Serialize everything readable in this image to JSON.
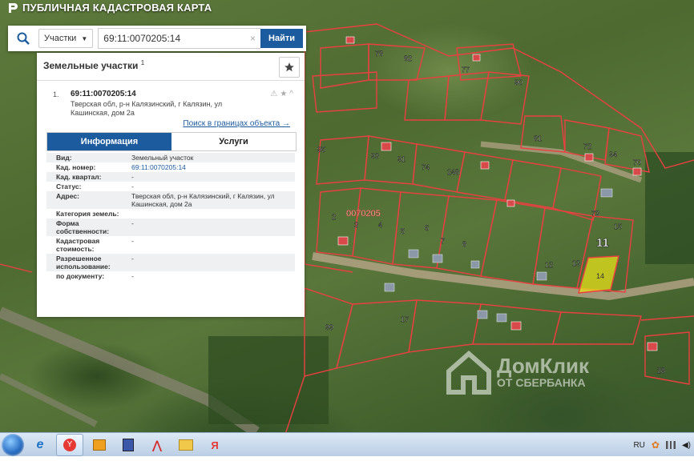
{
  "app": {
    "title": "ПУБЛИЧНАЯ КАДАСТРОВАЯ КАРТА"
  },
  "search": {
    "type_label": "Участки",
    "query": "69:11:0070205:14",
    "clear": "×",
    "find_label": "Найти"
  },
  "panel": {
    "title": "Земельные участки",
    "count": "1",
    "result": {
      "number": "1.",
      "id": "69:11:0070205:14",
      "address": "Тверская обл, р-н Калязинский, г Калязин, ул Кашинская, дом 2а",
      "search_link": "Поиск в границах объекта →"
    },
    "tabs": [
      {
        "label": "Информация"
      },
      {
        "label": "Услуги"
      }
    ],
    "rows": [
      {
        "k": "Вид:",
        "v": "Земельный участок"
      },
      {
        "k": "Кад. номер:",
        "v": "69:11:0070205:14"
      },
      {
        "k": "Кад. квартал:",
        "v": "-"
      },
      {
        "k": "Статус:",
        "v": "-"
      },
      {
        "k": "Адрес:",
        "v": "Тверская обл, р-н Калязинский, г Калязин, ул Кашинская, дом 2а"
      },
      {
        "k": "Категория земель:",
        "v": ""
      },
      {
        "k": "Форма собственности:",
        "v": "-"
      },
      {
        "k": "Кадастровая стоимость:",
        "v": "-"
      },
      {
        "k": "Разрешенное использование:",
        "v": "-"
      },
      {
        "k": "по документу:",
        "v": "-"
      }
    ]
  },
  "map": {
    "quarter_label": "0070205",
    "block_label": "11",
    "parcel_labels": [
      "95",
      "93",
      "91",
      "74",
      "248",
      "2",
      "3",
      "4",
      "5",
      "6",
      "7",
      "8",
      "12",
      "13",
      "14",
      "15",
      "73",
      "70",
      "72",
      "94",
      "81",
      "77",
      "78",
      "82",
      "90",
      "99",
      "17",
      "49",
      "4ж",
      "248"
    ],
    "highlight_label": "14"
  },
  "watermark": {
    "main": "ДомКлик",
    "sub": "ОТ СБЕРБАНКА"
  },
  "taskbar": {
    "lang": "RU"
  },
  "colors": {
    "brand_blue": "#1c5b9e",
    "parcel_line": "#d23a3a",
    "highlight": "#e7e21a"
  }
}
